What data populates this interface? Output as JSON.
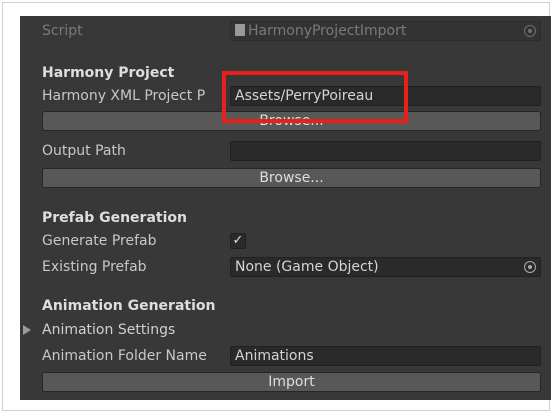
{
  "script": {
    "label": "Script",
    "value": "HarmonyProjectImport",
    "icon": "script-file-icon"
  },
  "harmony_project": {
    "header": "Harmony Project",
    "xml_path_label": "Harmony XML Project P",
    "xml_path_value": "Assets/PerryPoireau",
    "browse_label": "Browse..."
  },
  "output": {
    "label": "Output Path",
    "value": "",
    "browse_label": "Browse..."
  },
  "prefab_generation": {
    "header": "Prefab Generation",
    "generate_label": "Generate Prefab",
    "generate_checked": true,
    "existing_label": "Existing Prefab",
    "existing_value": "None (Game Object)"
  },
  "animation_generation": {
    "header": "Animation Generation",
    "settings_label": "Animation Settings",
    "folder_label": "Animation Folder Name",
    "folder_value": "Animations",
    "import_label": "Import"
  },
  "colors": {
    "panel_bg": "#383838",
    "field_bg": "#2a2a2a",
    "button_bg": "#585858",
    "highlight": "#e8201c"
  }
}
